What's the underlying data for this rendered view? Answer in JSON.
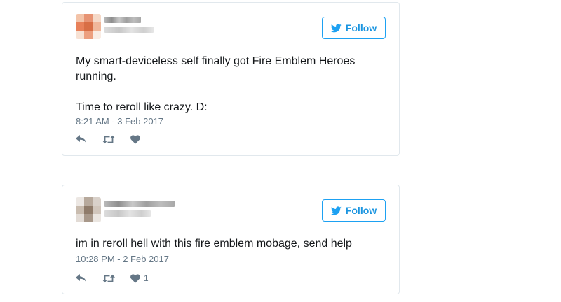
{
  "tweets": [
    {
      "follow_label": "Follow",
      "text": "My smart-deviceless self finally got Fire Emblem Heroes running.\n\nTime to reroll like crazy. D:",
      "timestamp": "8:21 AM - 3 Feb 2017",
      "like_count": ""
    },
    {
      "follow_label": "Follow",
      "text": "im in reroll hell with this fire emblem mobage, send help",
      "timestamp": "10:28 PM - 2 Feb 2017",
      "like_count": "1"
    }
  ],
  "colors": {
    "accent": "#1da1f2",
    "meta_text": "#657786",
    "border": "#e1e8ed"
  },
  "icons": [
    "twitter-bird-icon",
    "reply-icon",
    "retweet-icon",
    "heart-icon"
  ]
}
